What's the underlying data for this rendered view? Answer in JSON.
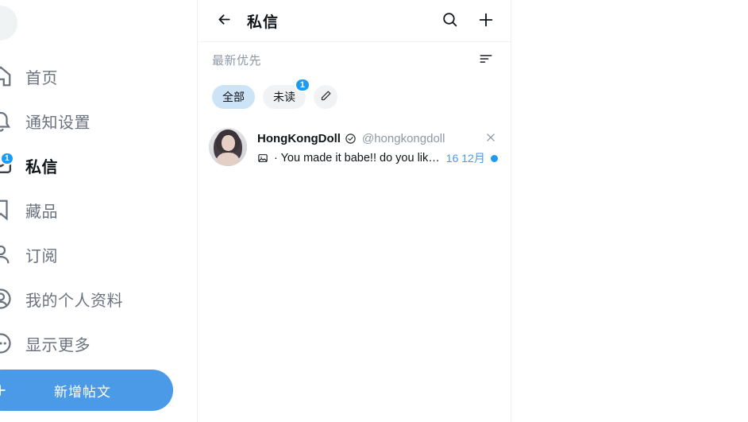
{
  "sidebar": {
    "avatar_name": "user-avatar-placeholder",
    "items": [
      {
        "id": "home",
        "label": "首页",
        "icon": "home-icon",
        "active": false,
        "badge": null
      },
      {
        "id": "notifications",
        "label": "通知设置",
        "icon": "bell-icon",
        "active": false,
        "badge": null
      },
      {
        "id": "messages",
        "label": "私信",
        "icon": "envelope-icon",
        "active": true,
        "badge": "1"
      },
      {
        "id": "collections",
        "label": "藏品",
        "icon": "bookmark-icon",
        "active": false,
        "badge": null
      },
      {
        "id": "subscriptions",
        "label": "订阅",
        "icon": "person-icon",
        "active": false,
        "badge": null
      },
      {
        "id": "profile",
        "label": "我的个人资料",
        "icon": "profile-circle-icon",
        "active": false,
        "badge": null
      },
      {
        "id": "more",
        "label": "显示更多",
        "icon": "more-circle-icon",
        "active": false,
        "badge": null
      }
    ],
    "compose_button": {
      "label": "新增帖文",
      "icon": "plus-icon",
      "color": "#4a9ae8"
    }
  },
  "dm_panel": {
    "header": {
      "back_icon": "arrow-left-icon",
      "title": "私信",
      "search_icon": "search-icon",
      "add_icon": "plus-icon"
    },
    "sort": {
      "label": "最新优先",
      "icon": "sort-icon"
    },
    "filters": [
      {
        "id": "all",
        "label": "全部",
        "active": true,
        "badge": null
      },
      {
        "id": "unread",
        "label": "未读",
        "active": false,
        "badge": "1"
      }
    ],
    "edit_filter_icon": "pencil-icon",
    "conversations": [
      {
        "name": "HongKongDoll",
        "verified": true,
        "verified_icon": "verified-badge-icon",
        "handle": "@hongkongdoll",
        "message_icon": "image-attachment-icon",
        "preview": "· You made it babe!! do you lik…",
        "date": "16 12月",
        "unread": true,
        "close_icon": "close-icon",
        "avatar_name": "hongkongdoll-avatar"
      }
    ]
  },
  "colors": {
    "accent_blue": "#1d9bf0",
    "button_blue": "#4a9ae8",
    "chip_active_bg": "#cde4f7",
    "chip_bg": "#f0f2f4",
    "text_primary": "#0f1419",
    "text_muted": "#8b98a5",
    "border": "#eff3f4"
  }
}
